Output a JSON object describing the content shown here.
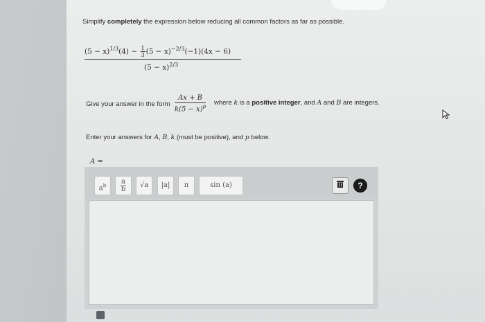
{
  "instructions": {
    "simplify_pre": "Simplify ",
    "simplify_bold": "completely",
    "simplify_post": " the expression below reducing all common factors as far as possible.",
    "give_pre": "Give your answer in the form",
    "give_where": "where",
    "give_k": "k",
    "give_is": "is a",
    "give_bold": "positive integer",
    "give_and": ", and",
    "give_A": "A",
    "give_and2": "and",
    "give_B": "B",
    "give_post": "are integers.",
    "enter_text": "Enter your answers for",
    "enter_A": "A",
    "enter_comma1": ",",
    "enter_B": "B",
    "enter_comma2": ",",
    "enter_k": "k",
    "enter_paren": "(must be positive), and",
    "enter_p": "p",
    "enter_below": "below."
  },
  "expression": {
    "n1": "(5 − x)",
    "n1_exp": "1/3",
    "n2": "(4) −",
    "frac_num": "1",
    "frac_den": "3",
    "n3": "(5 − x)",
    "n3_exp": "−2/3",
    "n4": "(−1)(4x − 6)",
    "den": "(5 − x)",
    "den_exp": "2/3"
  },
  "answer_form": {
    "numerator": "Ax + B",
    "denominator": "k(5 − x)",
    "denominator_exp": "p"
  },
  "answer_label": "A =",
  "toolbar": {
    "power_label": "a",
    "power_sup": "b",
    "fraction_num": "a",
    "fraction_den": "b",
    "sqrt_label": "√a",
    "abs_label": "|a|",
    "pi_label": "π",
    "sin_label": "sin (a)",
    "help_label": "?"
  }
}
